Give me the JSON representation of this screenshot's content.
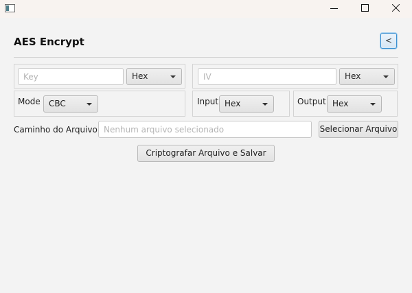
{
  "window": {
    "app_icon": "window-app-icon",
    "controls": [
      "minimize",
      "maximize",
      "close"
    ]
  },
  "header": {
    "title": "AES Encrypt",
    "back_button_label": "<"
  },
  "key_group": {
    "key_placeholder": "Key",
    "key_value": "",
    "key_format": "Hex"
  },
  "iv_group": {
    "iv_placeholder": "IV",
    "iv_value": "",
    "iv_format": "Hex"
  },
  "mode_group": {
    "label": "Mode",
    "value": "CBC"
  },
  "input_group": {
    "label": "Input",
    "value": "Hex"
  },
  "output_group": {
    "label": "Output",
    "value": "Hex"
  },
  "file": {
    "path_label": "Caminho do Arquivo:",
    "path_placeholder": "Nenhum arquivo selecionado",
    "path_value": "",
    "select_button_label": "Selecionar Arquivo",
    "encrypt_button_label": "Criptografar Arquivo e Salvar"
  },
  "colors": {
    "background": "#f3f3f3",
    "titlebar": "#f8f3f0",
    "focus_accent": "#3a8fd0"
  }
}
